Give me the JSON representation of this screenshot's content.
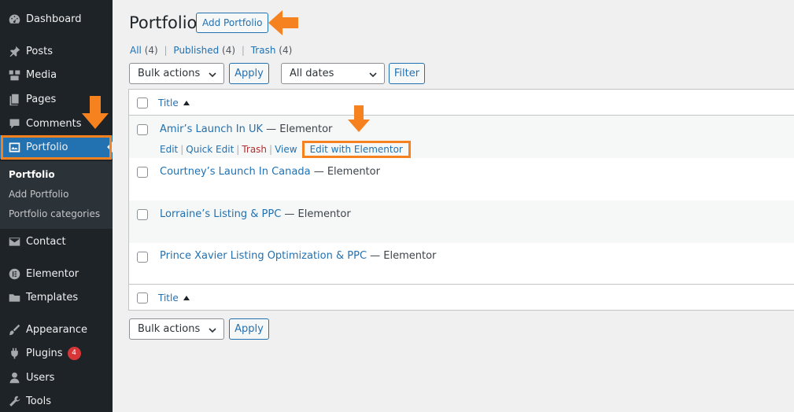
{
  "sidebar": {
    "items": [
      {
        "label": "Dashboard",
        "icon": "dashboard-icon"
      },
      {
        "label": "Posts",
        "icon": "pin-icon"
      },
      {
        "label": "Media",
        "icon": "media-icon"
      },
      {
        "label": "Pages",
        "icon": "pages-icon"
      },
      {
        "label": "Comments",
        "icon": "comment-icon"
      },
      {
        "label": "Portfolio",
        "icon": "portfolio-icon"
      },
      {
        "label": "Contact",
        "icon": "mail-icon"
      },
      {
        "label": "Elementor",
        "icon": "elementor-icon"
      },
      {
        "label": "Templates",
        "icon": "folder-icon"
      },
      {
        "label": "Appearance",
        "icon": "brush-icon"
      },
      {
        "label": "Plugins",
        "icon": "plugin-icon"
      },
      {
        "label": "Users",
        "icon": "user-icon"
      },
      {
        "label": "Tools",
        "icon": "wrench-icon"
      }
    ],
    "plugins_badge": "4",
    "submenu": [
      "Portfolio",
      "Add Portfolio",
      "Portfolio categories"
    ]
  },
  "page": {
    "title": "Portfolio",
    "add_button": "Add Portfolio"
  },
  "filters": {
    "all": "All",
    "all_count": "(4)",
    "published": "Published",
    "published_count": "(4)",
    "trash": "Trash",
    "trash_count": "(4)",
    "sep": "|"
  },
  "controls": {
    "bulk_actions": "Bulk actions",
    "apply": "Apply",
    "all_dates": "All dates",
    "filter": "Filter"
  },
  "table": {
    "column_title": "Title",
    "rows": [
      {
        "title": "Amir’s Launch In UK",
        "state": " — Elementor"
      },
      {
        "title": "Courtney’s Launch In Canada",
        "state": " — Elementor"
      },
      {
        "title": "Lorraine’s Listing & PPC",
        "state": " — Elementor"
      },
      {
        "title": "Prince Xavier Listing Optimization & PPC",
        "state": " — Elementor"
      }
    ],
    "row_actions": {
      "edit": "Edit",
      "quick_edit": "Quick Edit",
      "trash": "Trash",
      "view": "View",
      "edit_elementor": "Edit with Elementor",
      "pipe": "|"
    }
  },
  "colors": {
    "annotation": "#f6821f",
    "link": "#2271b1",
    "sidebar_bg": "#1d2327",
    "current_bg": "#2271b1"
  }
}
